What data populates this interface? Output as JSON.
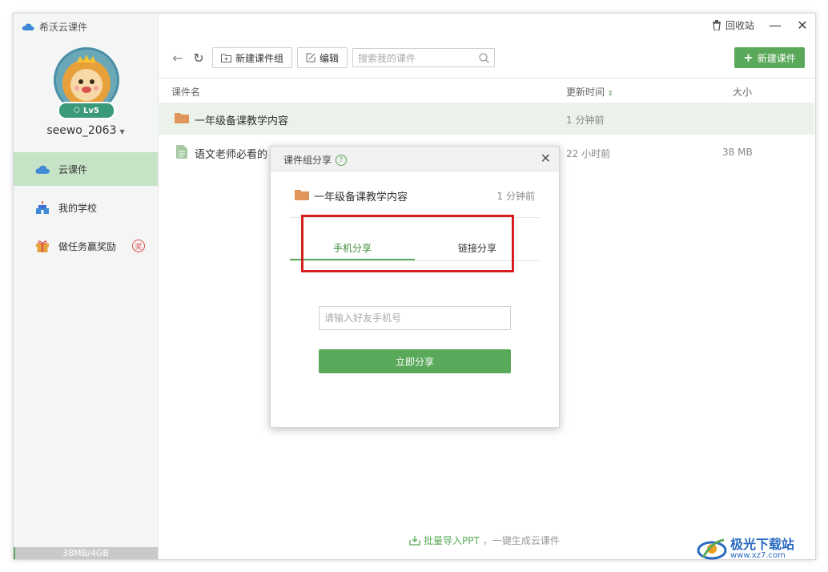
{
  "app": {
    "title": "希沃云课件"
  },
  "user": {
    "level": "Lv5",
    "name": "seewo_2063"
  },
  "sidebar": {
    "items": [
      {
        "label": "云课件",
        "icon": "cloud-icon",
        "active": true
      },
      {
        "label": "我的学校",
        "icon": "school-icon",
        "active": false
      },
      {
        "label": "做任务赢奖励",
        "icon": "gift-icon",
        "active": false,
        "badge": "奖"
      }
    ],
    "storage": {
      "text": "38MB/4GB",
      "used_fraction": 0.0093
    }
  },
  "titlebar": {
    "recycle_label": "回收站"
  },
  "toolbar": {
    "new_group_label": "新建课件组",
    "edit_label": "编辑",
    "search_placeholder": "搜索我的课件",
    "new_courseware_label": "新建课件"
  },
  "table": {
    "columns": {
      "name": "课件名",
      "time": "更新时间",
      "size": "大小"
    },
    "rows": [
      {
        "name": "一年级备课教学内容",
        "time": "1 分钟前",
        "size": "",
        "type": "folder"
      },
      {
        "name": "语文老师必看的",
        "time": "22 小时前",
        "size": "38 MB",
        "type": "file"
      }
    ]
  },
  "footer": {
    "link": "批量导入PPT",
    "text": "，一键生成云课件"
  },
  "dialog": {
    "title": "课件组分享",
    "file_name": "一年级备课教学内容",
    "file_time": "1 分钟前",
    "tabs": [
      "手机分享",
      "链接分享"
    ],
    "active_tab": 0,
    "phone_placeholder": "请输入好友手机号",
    "share_button": "立即分享"
  },
  "watermark": {
    "title": "极光下载站",
    "url": "www.xz7.com"
  },
  "colors": {
    "accent": "#5aa95a",
    "highlight": "#d62020"
  }
}
